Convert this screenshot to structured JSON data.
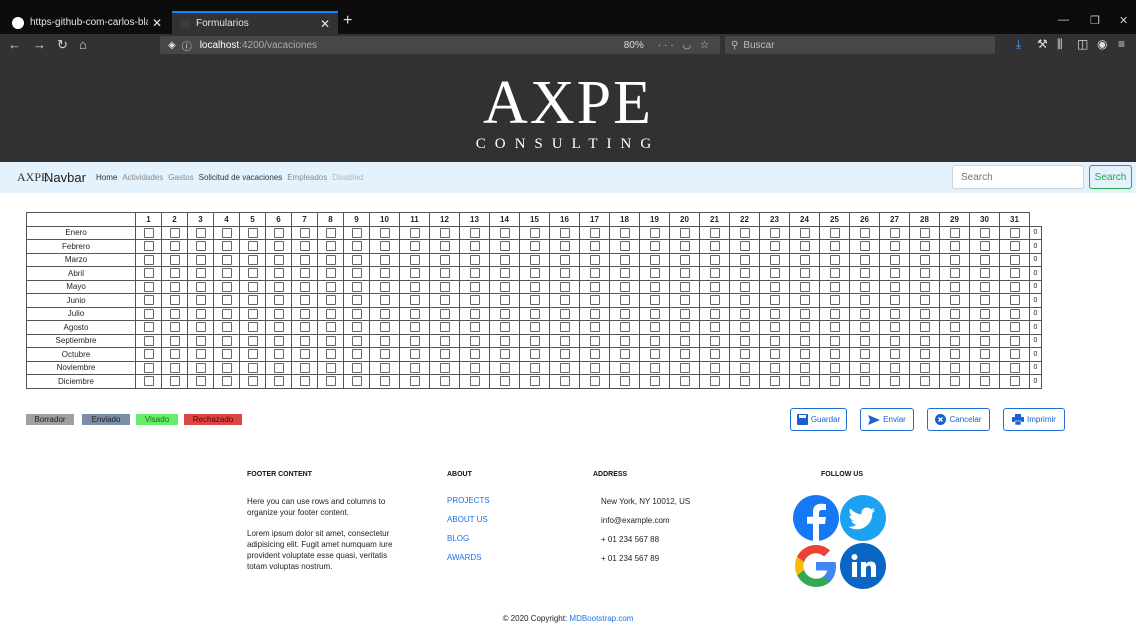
{
  "browser": {
    "tabs": [
      {
        "title": "https-github-com-carlos-blanc",
        "close": "✕"
      },
      {
        "title": "Formularios",
        "close": "✕"
      }
    ],
    "new_tab": "+",
    "url_host": "localhost",
    "url_path": ":4200/vacaciones",
    "zoom": "80%",
    "search_placeholder": "Buscar"
  },
  "hero": {
    "logo_main": "AXPE",
    "logo_sub": "CONSULTING"
  },
  "appnav": {
    "brand_logo": "AXPE",
    "brand": "Navbar",
    "links": [
      {
        "label": "Home",
        "state": "active"
      },
      {
        "label": "Actividades",
        "state": "normal"
      },
      {
        "label": "Gastos",
        "state": "normal"
      },
      {
        "label": "Solicitud de vacaciones",
        "state": "active"
      },
      {
        "label": "Empleados",
        "state": "normal"
      },
      {
        "label": "Disabled",
        "state": "disabled"
      }
    ],
    "search_placeholder": "Search",
    "search_button": "Search"
  },
  "calendar": {
    "days": [
      "1",
      "2",
      "3",
      "4",
      "5",
      "6",
      "7",
      "8",
      "9",
      "10",
      "11",
      "12",
      "13",
      "14",
      "15",
      "16",
      "17",
      "18",
      "19",
      "20",
      "21",
      "22",
      "23",
      "24",
      "25",
      "26",
      "27",
      "28",
      "29",
      "30",
      "31"
    ],
    "months": [
      "Enero",
      "Febrero",
      "Marzo",
      "Abril",
      "Mayo",
      "Junio",
      "Julio",
      "Agosto",
      "Septiembre",
      "Octubre",
      "Noviembre",
      "Diciembre"
    ],
    "counts": [
      "0",
      "0",
      "0",
      "0",
      "0",
      "0",
      "0",
      "0",
      "0",
      "0",
      "0",
      "0"
    ]
  },
  "legend": [
    {
      "label": "Borrador",
      "color": "#a0a0a0"
    },
    {
      "label": "Enviado",
      "color": "#7b8ea5"
    },
    {
      "label": "Visado",
      "color": "#66ee66"
    },
    {
      "label": "Rechazado",
      "color": "#dd4444"
    }
  ],
  "actions": {
    "save": "Guardar",
    "send": "Enviar",
    "cancel": "Cancelar",
    "print": "Imprimir"
  },
  "footer": {
    "content_title": "FOOTER CONTENT",
    "content_p1": "Here you can use rows and columns to organize your footer content.",
    "content_p2": "Lorem ipsum dolor sit amet, consectetur adipisicing elit. Fugit amet numquam iure provident voluptate esse quasi, veritatis totam voluptas nostrum.",
    "about_title": "ABOUT",
    "about_links": [
      "PROJECTS",
      "ABOUT US",
      "BLOG",
      "AWARDS"
    ],
    "address_title": "ADDRESS",
    "address_lines": [
      "New York, NY 10012, US",
      "info@example.com",
      "+ 01 234 567 88",
      "+ 01 234 567 89"
    ],
    "follow_title": "FOLLOW US",
    "copyright": "© 2020 Copyright:",
    "copyright_link": "MDBootstrap.com"
  }
}
